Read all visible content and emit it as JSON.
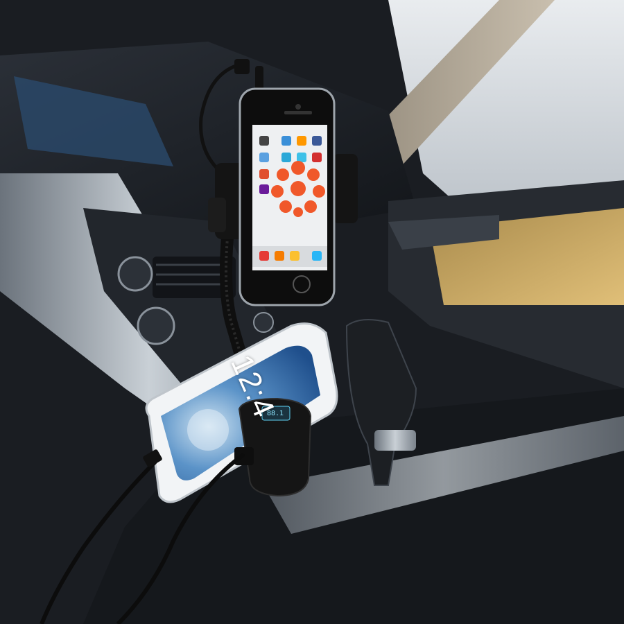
{
  "scene": {
    "colors": {
      "dashboard_dark": "#1d2127",
      "dashboard_silver": "#9aa3ac",
      "door_trim_tan": "#c8a560",
      "mount_black": "#141414",
      "iphone_screen": "#eef0f2",
      "android_screen": "#2f6fb8",
      "fm_display": "#5fd3f5"
    },
    "icons": [
      "iphone-icon",
      "android-phone-icon",
      "fm-transmitter-icon",
      "gooseneck-mount-icon",
      "usb-cable-icon"
    ]
  },
  "android_phone": {
    "clock": "12:4"
  },
  "fm_transmitter": {
    "readout": "88.1"
  }
}
